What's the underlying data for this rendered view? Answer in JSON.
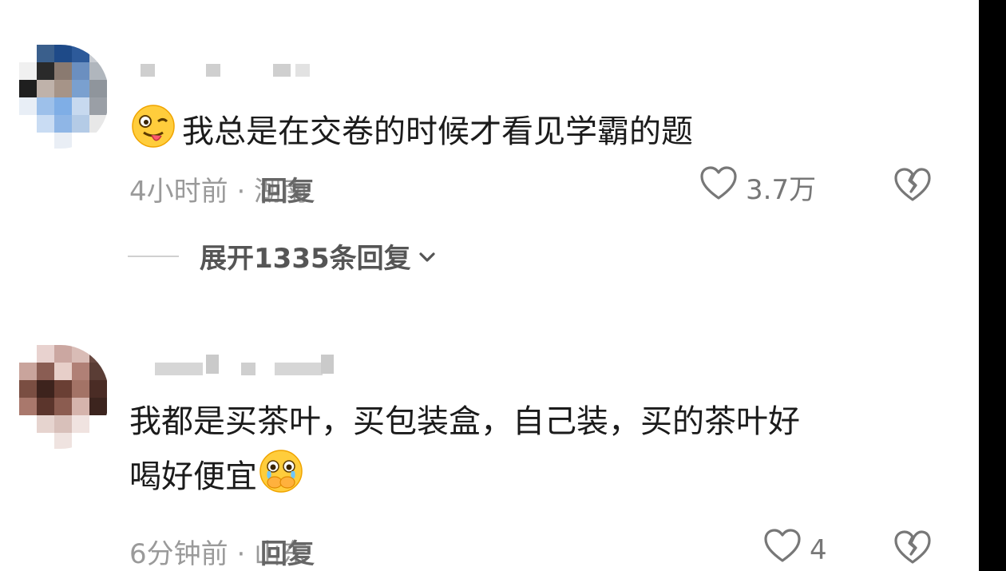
{
  "comments": [
    {
      "text": "我总是在交卷的时候才看见学霸的题",
      "emoji": "winking-tongue-emoji",
      "meta": "4小时前 · 湖南",
      "reply_label": "回复",
      "likes": "3.7万",
      "expand_label": "展开1335条回复"
    },
    {
      "text_line1": "我都是买茶叶，买包装盒，自己装，买的茶叶好",
      "text_line2": "喝好便宜",
      "emoji": "crying-covering-mouth-emoji",
      "meta": "6分钟前 · 山东",
      "reply_label": "回复",
      "likes": "4"
    }
  ]
}
